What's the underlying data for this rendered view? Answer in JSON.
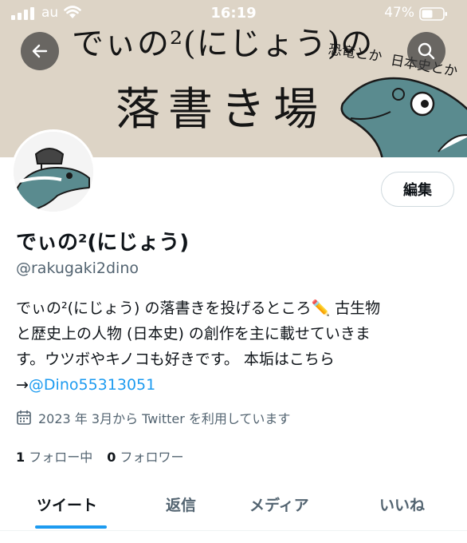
{
  "status_bar": {
    "carrier": "au",
    "time": "16:19",
    "battery": "47%"
  },
  "banner": {
    "title_line1": "でぃの²(にじょう)の",
    "title_line2": "落書き場",
    "note1": "恐竜とか",
    "note2": "日本史とか"
  },
  "profile": {
    "edit_label": "編集",
    "display_name": "でぃの²(にじょう)",
    "handle": "@rakugaki2dino",
    "bio_line1": "でぃの²(にじょう) の落書きを投げるところ✏️ 古生物",
    "bio_line2": "と歴史上の人物 (日本史) の創作を主に載せていきま",
    "bio_line3": "す。ウツボやキノコも好きです。 本垢はこちら",
    "bio_arrow": "→",
    "bio_link": "@Dino55313051",
    "joined": "2023 年 3月から Twitter を利用しています",
    "following_count": "1",
    "following_label": "フォロー中",
    "followers_count": "0",
    "followers_label": "フォロワー"
  },
  "tabs": [
    {
      "label": "ツイート"
    },
    {
      "label": "返信"
    },
    {
      "label": "メディア"
    },
    {
      "label": "いいね"
    }
  ],
  "colors": {
    "accent": "#1d9bf0",
    "banner_bg": "#ddd4c6",
    "secondary_text": "#536471"
  }
}
